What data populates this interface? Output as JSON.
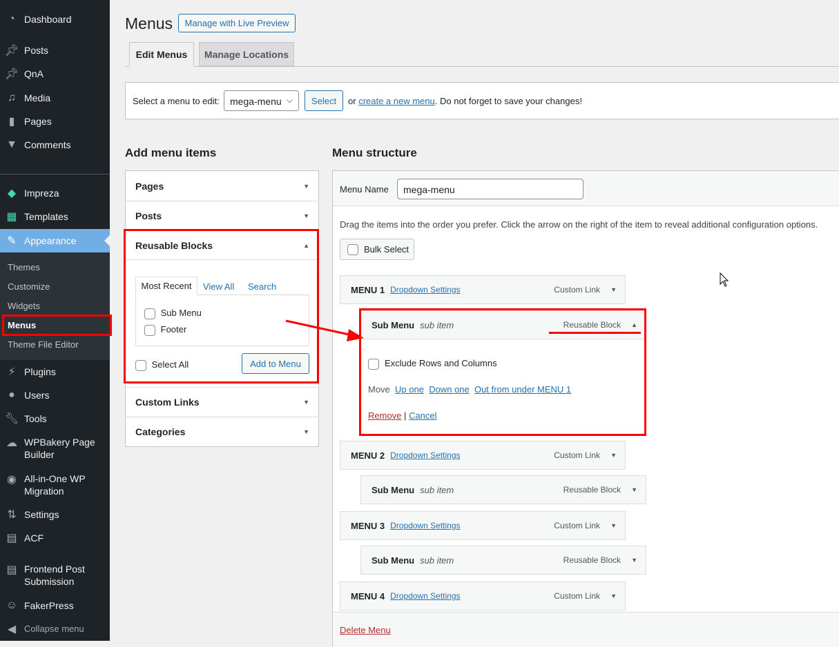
{
  "sidebar": {
    "items": [
      {
        "label": "Dashboard",
        "icon": "dashboard-icon"
      },
      {
        "label": "Posts",
        "icon": "pin-icon"
      },
      {
        "label": "QnA",
        "icon": "pin-icon"
      },
      {
        "label": "Media",
        "icon": "media-icon"
      },
      {
        "label": "Pages",
        "icon": "pages-icon"
      },
      {
        "label": "Comments",
        "icon": "comment-icon"
      },
      {
        "label": "Impreza",
        "icon": "diamond-icon"
      },
      {
        "label": "Templates",
        "icon": "templates-icon"
      },
      {
        "label": "Appearance",
        "icon": "brush-icon"
      },
      {
        "label": "Plugins",
        "icon": "plugin-icon"
      },
      {
        "label": "Users",
        "icon": "user-icon"
      },
      {
        "label": "Tools",
        "icon": "wrench-icon"
      },
      {
        "label": "WPBakery Page Builder",
        "icon": "cloud-icon"
      },
      {
        "label": "All-in-One WP Migration",
        "icon": "migration-icon"
      },
      {
        "label": "Settings",
        "icon": "settings-icon"
      },
      {
        "label": "ACF",
        "icon": "acf-icon"
      },
      {
        "label": "Frontend Post Submission",
        "icon": "form-icon"
      },
      {
        "label": "FakerPress",
        "icon": "accessibility-icon"
      },
      {
        "label": "Collapse menu",
        "icon": "collapse-icon"
      }
    ],
    "appearance_sub": [
      "Themes",
      "Customize",
      "Widgets",
      "Menus",
      "Theme File Editor"
    ]
  },
  "header": {
    "title": "Menus",
    "live_preview": "Manage with Live Preview",
    "tabs": [
      "Edit Menus",
      "Manage Locations"
    ]
  },
  "select_bar": {
    "label": "Select a menu to edit:",
    "value": "mega-menu",
    "select_btn": "Select",
    "or": "or",
    "create_link": "create a new menu",
    "suffix": ". Do not forget to save your changes!"
  },
  "add_items": {
    "heading": "Add menu items",
    "sections": [
      "Pages",
      "Posts",
      "Reusable Blocks",
      "Custom Links",
      "Categories"
    ],
    "tabs": [
      "Most Recent",
      "View All",
      "Search"
    ],
    "options": [
      "Sub Menu",
      "Footer"
    ],
    "select_all": "Select All",
    "add_btn": "Add to Menu"
  },
  "structure": {
    "heading": "Menu structure",
    "name_label": "Menu Name",
    "name_value": "mega-menu",
    "instructions": "Drag the items into the order you prefer. Click the arrow on the right of the item to reveal additional configuration options.",
    "bulk_select": "Bulk Select",
    "items": [
      {
        "title": "MENU 1",
        "link": "Dropdown Settings",
        "type": "Custom Link"
      },
      {
        "title": "Sub Menu",
        "sub": "sub item",
        "type": "Reusable Block"
      },
      {
        "title": "MENU 2",
        "link": "Dropdown Settings",
        "type": "Custom Link"
      },
      {
        "title": "Sub Menu",
        "sub": "sub item",
        "type": "Reusable Block"
      },
      {
        "title": "MENU 3",
        "link": "Dropdown Settings",
        "type": "Custom Link"
      },
      {
        "title": "Sub Menu",
        "sub": "sub item",
        "type": "Reusable Block"
      },
      {
        "title": "MENU 4",
        "link": "Dropdown Settings",
        "type": "Custom Link"
      }
    ],
    "expanded": {
      "exclude": "Exclude Rows and Columns",
      "move": "Move",
      "up": "Up one",
      "down": "Down one",
      "out": "Out from under MENU 1",
      "remove": "Remove",
      "sep": "|",
      "cancel": "Cancel"
    },
    "delete": "Delete Menu"
  },
  "colors": {
    "sidebar": "#1d2327",
    "active": "#72aee6",
    "accent": "#2271b1",
    "annotation": "#ff0000"
  }
}
